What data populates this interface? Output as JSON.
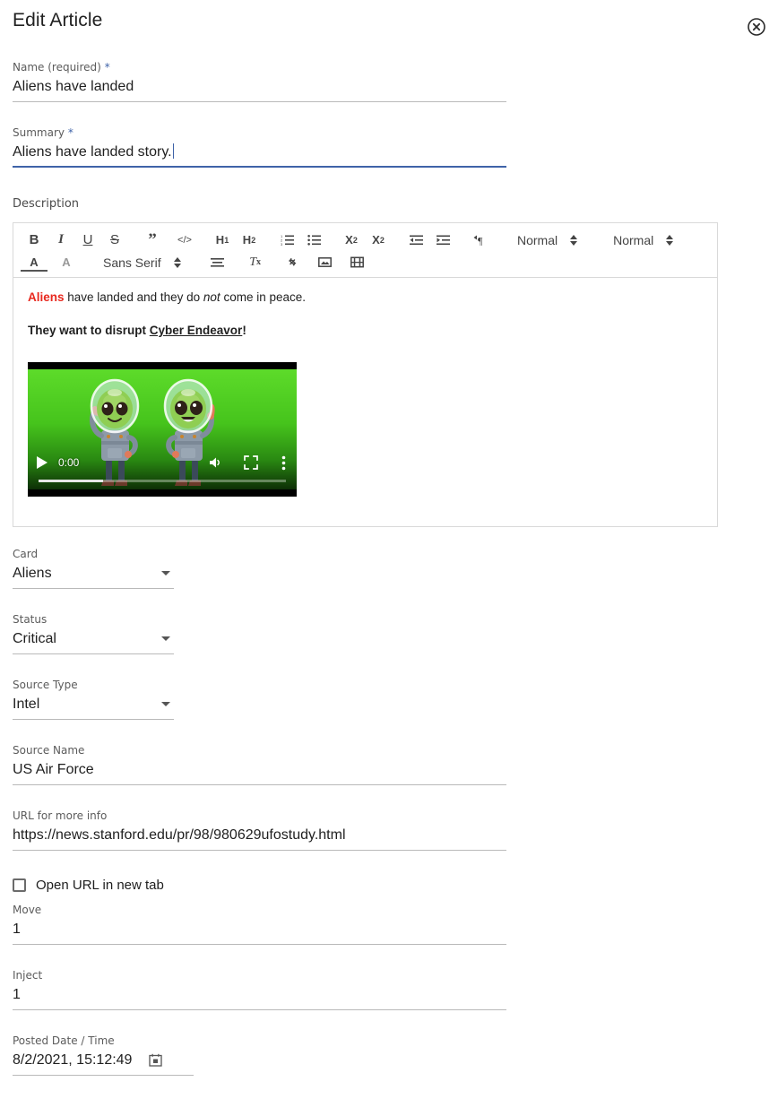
{
  "dialog": {
    "title": "Edit Article",
    "close_icon": "close-circle-icon"
  },
  "fields": {
    "name": {
      "label": "Name (required) ",
      "required_mark": "*",
      "value": "Aliens have landed"
    },
    "summary": {
      "label": "Summary ",
      "required_mark": "*",
      "value": "Aliens have landed story."
    },
    "description": {
      "label": "Description"
    },
    "card": {
      "label": "Card",
      "value": "Aliens"
    },
    "status": {
      "label": "Status",
      "value": "Critical"
    },
    "source_type": {
      "label": "Source Type",
      "value": "Intel"
    },
    "source_name": {
      "label": "Source Name",
      "value": "US Air Force"
    },
    "url": {
      "label": "URL for more info",
      "value": "https://news.stanford.edu/pr/98/980629ufostudy.html"
    },
    "open_new_tab": {
      "label": "Open URL in new tab",
      "checked": false
    },
    "move": {
      "label": "Move",
      "value": "1"
    },
    "inject": {
      "label": "Inject",
      "value": "1"
    },
    "posted": {
      "label": "Posted Date / Time",
      "value": "8/2/2021, 15:12:49",
      "calendar_icon": "calendar-icon"
    }
  },
  "editor": {
    "toolbar_row1": [
      {
        "name": "bold-button",
        "glyph": "B"
      },
      {
        "name": "italic-button",
        "glyph": "I"
      },
      {
        "name": "underline-button",
        "glyph": "U"
      },
      {
        "name": "strikethrough-button",
        "glyph": "S"
      },
      {
        "name": "blockquote-button",
        "glyph": "”"
      },
      {
        "name": "code-block-button",
        "glyph": "</>"
      },
      {
        "name": "heading-1-button",
        "glyph": "H1"
      },
      {
        "name": "heading-2-button",
        "glyph": "H2"
      },
      {
        "name": "ordered-list-button",
        "glyph": "list-ol"
      },
      {
        "name": "bullet-list-button",
        "glyph": "list-ul"
      },
      {
        "name": "subscript-button",
        "glyph": "X2sub"
      },
      {
        "name": "superscript-button",
        "glyph": "X2sup"
      },
      {
        "name": "outdent-button",
        "glyph": "outdent"
      },
      {
        "name": "indent-button",
        "glyph": "indent"
      },
      {
        "name": "text-direction-button",
        "glyph": "pilcrow"
      }
    ],
    "size_picker": {
      "label": "Normal",
      "name": "font-size-picker"
    },
    "header_picker": {
      "label": "Normal",
      "name": "header-style-picker"
    },
    "font_picker": {
      "label": "Sans Serif",
      "name": "font-family-picker"
    },
    "toolbar_row2": [
      {
        "name": "font-color-button",
        "glyph": "A"
      },
      {
        "name": "background-color-button",
        "glyph": "A-bg"
      },
      {
        "name": "align-button",
        "glyph": "align"
      },
      {
        "name": "clear-formatting-button",
        "glyph": "Tx"
      },
      {
        "name": "insert-link-button",
        "glyph": "link"
      },
      {
        "name": "insert-image-button",
        "glyph": "image"
      },
      {
        "name": "insert-video-button",
        "glyph": "video"
      }
    ],
    "content": {
      "p1_red": "Aliens",
      "p1_a": " have landed and they do ",
      "p1_italic": "not",
      "p1_b": " come in peace.",
      "p2_a": "They want to disrupt ",
      "p2_link": "Cyber Endeavor",
      "p2_b": "!"
    },
    "video": {
      "time": "0:00",
      "play_icon": "play-icon",
      "mute_icon": "volume-icon",
      "fullscreen_icon": "fullscreen-icon",
      "more-options_icon": "kebab-menu-icon"
    }
  },
  "colors": {
    "accent": "#3f63a8",
    "red": "#e8281e",
    "underline": "#b9b9b9"
  }
}
